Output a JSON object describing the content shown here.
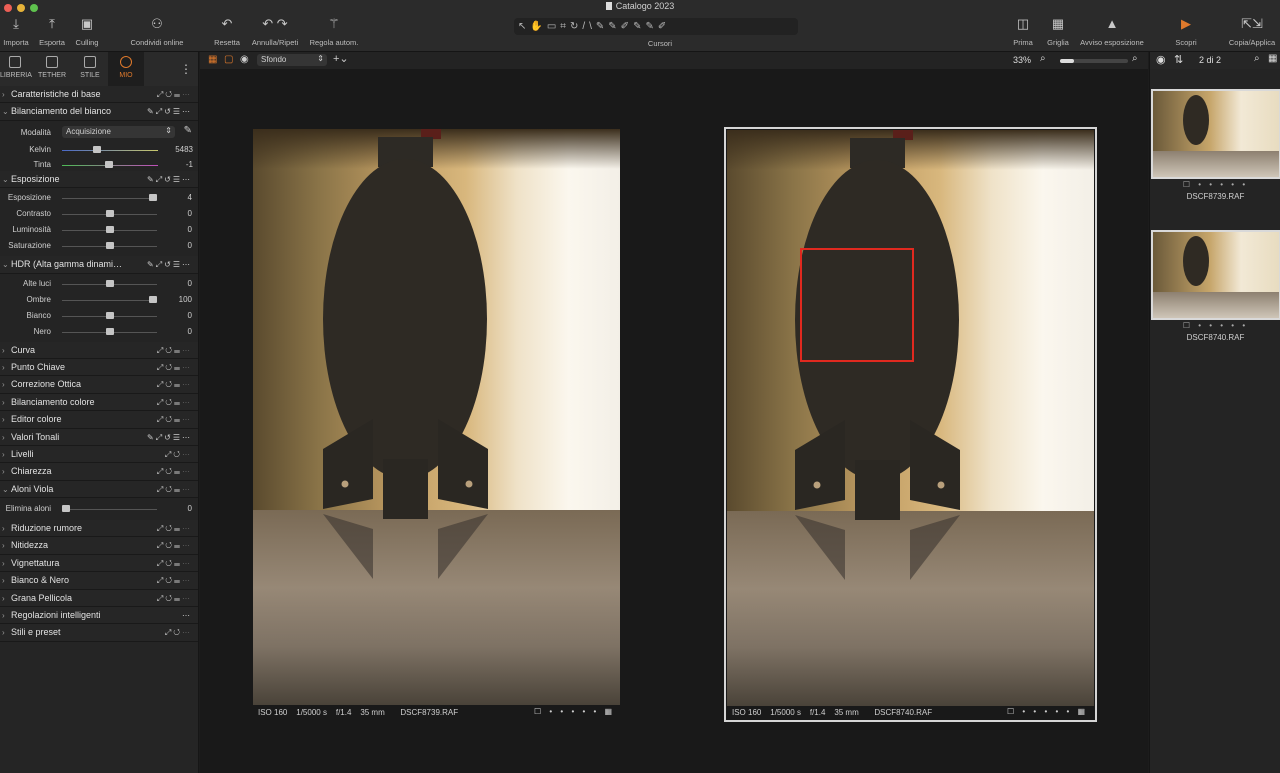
{
  "window": {
    "title": "Catalogo 2023"
  },
  "toolbar": {
    "importa": "Importa",
    "esporta": "Esporta",
    "culling": "Culling",
    "condividi": "Condividi online",
    "resetta": "Resetta",
    "annulla": "Annulla/Ripeti",
    "regola": "Regola autom.",
    "cursori": "Cursori",
    "prima": "Prima",
    "griglia": "Griglia",
    "avviso": "Avviso esposizione",
    "scopri": "Scopri",
    "copia": "Copia/Applica"
  },
  "left_tabs": [
    "LIBRERIA",
    "TETHER",
    "STILE",
    "MIO"
  ],
  "sections": {
    "caratteristiche": "Caratteristiche di base",
    "bilanciamento": "Bilanciamento del bianco",
    "modalita_label": "Modalità",
    "modalita_value": "Acquisizione",
    "kelvin": "Kelvin",
    "kelvin_val": "5483",
    "tinta": "Tinta",
    "tinta_val": "-1",
    "esposizione": "Esposizione",
    "esp_rows": [
      {
        "label": "Esposizione",
        "value": "4",
        "pos": 1.0
      },
      {
        "label": "Contrasto",
        "value": "0",
        "pos": 0.5
      },
      {
        "label": "Luminosità",
        "value": "0",
        "pos": 0.5
      },
      {
        "label": "Saturazione",
        "value": "0",
        "pos": 0.5
      }
    ],
    "hdr": "HDR (Alta gamma dinami…",
    "hdr_rows": [
      {
        "label": "Alte luci",
        "value": "0",
        "pos": 0.5
      },
      {
        "label": "Ombre",
        "value": "100",
        "pos": 1.0
      },
      {
        "label": "Bianco",
        "value": "0",
        "pos": 0.5
      },
      {
        "label": "Nero",
        "value": "0",
        "pos": 0.5
      }
    ],
    "curva": "Curva",
    "punto": "Punto Chiave",
    "correzione": "Correzione Ottica",
    "bil_colore": "Bilanciamento colore",
    "editor": "Editor colore",
    "valori": "Valori Tonali",
    "livelli": "Livelli",
    "chiarezza": "Chiarezza",
    "aloni": "Aloni Viola",
    "elimina_label": "Elimina aloni",
    "elimina_val": "0",
    "riduzione": "Riduzione rumore",
    "nitidezza": "Nitidezza",
    "vignettatura": "Vignettatura",
    "bianco_nero": "Bianco & Nero",
    "grana": "Grana Pellicola",
    "regolazioni": "Regolazioni intelligenti",
    "stili": "Stili e preset"
  },
  "viewbar": {
    "background": "Sfondo",
    "zoom": "33%"
  },
  "photos": [
    {
      "iso": "ISO 160",
      "shutter": "1/5000 s",
      "aperture": "f/1.4",
      "focal": "35 mm",
      "file": "DSCF8739.RAF"
    },
    {
      "iso": "ISO 160",
      "shutter": "1/5000 s",
      "aperture": "f/1.4",
      "focal": "35 mm",
      "file": "DSCF8740.RAF"
    }
  ],
  "browser": {
    "count": "2 di 2",
    "thumbs": [
      "DSCF8739.RAF",
      "DSCF8740.RAF"
    ]
  },
  "colors": {
    "accent": "#e07a2c",
    "selection": "#e0291f"
  }
}
